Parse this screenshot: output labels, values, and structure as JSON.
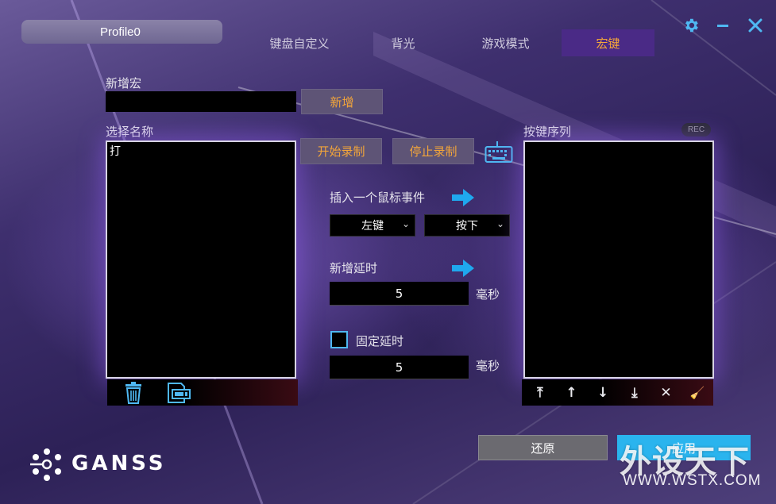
{
  "header": {
    "profile_name": "Profile0",
    "tabs": [
      {
        "label": "键盘自定义"
      },
      {
        "label": "背光"
      },
      {
        "label": "游戏模式"
      },
      {
        "label": "宏键"
      }
    ]
  },
  "new_macro": {
    "label": "新增宏",
    "input_value": "",
    "add_button": "新增"
  },
  "macro_names": {
    "label": "选择名称",
    "items": [
      "打"
    ]
  },
  "recording": {
    "start": "开始录制",
    "stop": "停止录制"
  },
  "mouse_event": {
    "label": "插入一个鼠标事件",
    "button_value": "左键",
    "action_value": "按下"
  },
  "add_delay": {
    "label": "新增延时",
    "value": "5",
    "unit": "毫秒"
  },
  "fixed_delay": {
    "label": "固定延时",
    "checked": false,
    "value": "5",
    "unit": "毫秒"
  },
  "key_sequence": {
    "label": "按键序列",
    "rec_badge": "REC",
    "tools": [
      "⤒",
      "↑",
      "↓",
      "⤓",
      "✕",
      "🧹"
    ]
  },
  "footer": {
    "restore_button": "还原",
    "apply_button": "应用",
    "brand_logo": "GANSS",
    "watermark_main": "外设天下",
    "watermark_url": "WWW.WSTX.COM"
  },
  "colors": {
    "accent_orange": "#f2a53a",
    "accent_blue": "#4fb8f2",
    "active_tab": "#4a2a86",
    "apply_button": "#2ab4ee"
  }
}
